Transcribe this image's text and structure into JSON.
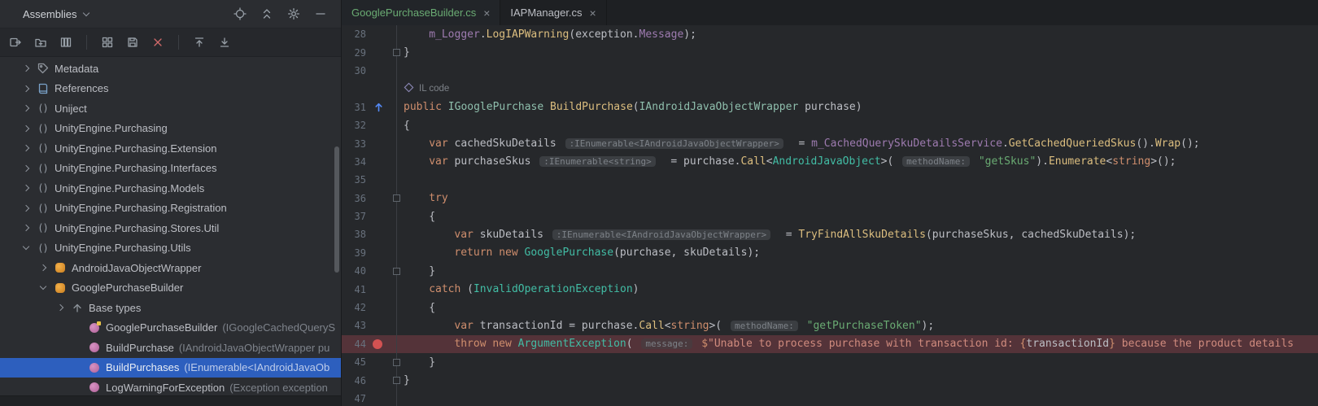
{
  "colors": {
    "selection_blue": "#2D5FBE",
    "tab_active_green": "#6AAB73",
    "breakpoint_red": "#D25252",
    "breakpoint_line_bg": "#543339",
    "keyword_orange": "#CF8E6D",
    "string_green": "#6AAB73"
  },
  "assembly_explorer": {
    "title": "Assemblies",
    "header_icons": [
      "locate-icon",
      "collapse-all-icon",
      "settings-icon",
      "hide-panel-icon"
    ],
    "toolbar_icons": [
      "open-assembly-icon",
      "attach-assembly-icon",
      "assembly-list-icon",
      "export-project-icon",
      "save-icon",
      "remove-assembly-icon",
      "collapse-to-top-icon",
      "expand-to-bottom-icon"
    ],
    "tree": [
      {
        "label": "Metadata",
        "icon": "metadata",
        "level": 0,
        "state": "collapsed"
      },
      {
        "label": "References",
        "icon": "references",
        "level": 0,
        "state": "collapsed"
      },
      {
        "label": "Uniject",
        "icon": "namespace",
        "level": 0,
        "state": "collapsed"
      },
      {
        "label": "UnityEngine.Purchasing",
        "icon": "namespace",
        "level": 0,
        "state": "collapsed"
      },
      {
        "label": "UnityEngine.Purchasing.Extension",
        "icon": "namespace",
        "level": 0,
        "state": "collapsed"
      },
      {
        "label": "UnityEngine.Purchasing.Interfaces",
        "icon": "namespace",
        "level": 0,
        "state": "collapsed"
      },
      {
        "label": "UnityEngine.Purchasing.Models",
        "icon": "namespace",
        "level": 0,
        "state": "collapsed"
      },
      {
        "label": "UnityEngine.Purchasing.Registration",
        "icon": "namespace",
        "level": 0,
        "state": "collapsed"
      },
      {
        "label": "UnityEngine.Purchasing.Stores.Util",
        "icon": "namespace",
        "level": 0,
        "state": "collapsed"
      },
      {
        "label": "UnityEngine.Purchasing.Utils",
        "icon": "namespace",
        "level": 0,
        "state": "expanded"
      },
      {
        "label": "AndroidJavaObjectWrapper",
        "icon": "class",
        "level": 1,
        "state": "collapsed"
      },
      {
        "label": "GooglePurchaseBuilder",
        "icon": "class",
        "level": 1,
        "state": "expanded"
      },
      {
        "label": "Base types",
        "icon": "base-types",
        "level": 2,
        "state": "collapsed"
      },
      {
        "label": "GooglePurchaseBuilder",
        "detail": "(IGoogleCachedQueryS",
        "icon": "constructor",
        "level": 2,
        "state": "leaf"
      },
      {
        "label": "BuildPurchase",
        "detail": "(IAndroidJavaObjectWrapper pu",
        "icon": "method",
        "level": 2,
        "state": "leaf"
      },
      {
        "label": "BuildPurchases",
        "detail": "(IEnumerable<IAndroidJavaOb",
        "icon": "method",
        "level": 2,
        "state": "leaf",
        "selected": true
      },
      {
        "label": "LogWarningForException",
        "detail": "(Exception exception",
        "icon": "method",
        "level": 2,
        "state": "leaf"
      }
    ]
  },
  "tabs": [
    {
      "label": "GooglePurchaseBuilder.cs",
      "active": true
    },
    {
      "label": "IAPManager.cs",
      "active": false
    }
  ],
  "editor": {
    "il_label": "IL code",
    "rows": [
      {
        "n": 28,
        "ind": 1,
        "t": [
          [
            "fld",
            "m_Logger"
          ],
          [
            "pl",
            "."
          ],
          [
            "mth",
            "LogIAPWarning"
          ],
          [
            "pl",
            "("
          ],
          [
            "pl",
            "exception"
          ],
          [
            "pl",
            "."
          ],
          [
            "fld",
            "Message"
          ],
          [
            "pl",
            ");"
          ]
        ]
      },
      {
        "n": 29,
        "ind": 0,
        "fold": true,
        "t": [
          [
            "pl",
            "}"
          ]
        ]
      },
      {
        "n": 30,
        "ind": 0,
        "t": []
      },
      {
        "inlay": true
      },
      {
        "n": 31,
        "ind": 0,
        "gutter_icon": "implements-arrow-icon",
        "t": [
          [
            "kw",
            "public "
          ],
          [
            "ifc",
            "IGooglePurchase "
          ],
          [
            "mth",
            "BuildPurchase"
          ],
          [
            "pl",
            "("
          ],
          [
            "ifc",
            "IAndroidJavaObjectWrapper"
          ],
          [
            "pl",
            " purchase)"
          ]
        ]
      },
      {
        "n": 32,
        "ind": 0,
        "t": [
          [
            "pl",
            "{"
          ]
        ]
      },
      {
        "n": 33,
        "ind": 1,
        "t": [
          [
            "kw",
            "var "
          ],
          [
            "pl",
            "cachedSkuDetails "
          ],
          [
            "hint",
            ":IEnumerable<IAndroidJavaObjectWrapper>"
          ],
          [
            "pl",
            "  = "
          ],
          [
            "fld",
            "m_CachedQuerySkuDetailsService"
          ],
          [
            "pl",
            "."
          ],
          [
            "mth",
            "GetCachedQueriedSkus"
          ],
          [
            "pl",
            "()."
          ],
          [
            "mth",
            "Wrap"
          ],
          [
            "pl",
            "();"
          ]
        ]
      },
      {
        "n": 34,
        "ind": 1,
        "t": [
          [
            "kw",
            "var "
          ],
          [
            "pl",
            "purchaseSkus "
          ],
          [
            "hint",
            ":IEnumerable<string>"
          ],
          [
            "pl",
            "  = purchase."
          ],
          [
            "mth",
            "Call"
          ],
          [
            "pl",
            "<"
          ],
          [
            "typ",
            "AndroidJavaObject"
          ],
          [
            "pl",
            ">( "
          ],
          [
            "hint",
            "methodName:"
          ],
          [
            "pl",
            " "
          ],
          [
            "str",
            "\"getSkus\""
          ],
          [
            "pl",
            ")."
          ],
          [
            "mth",
            "Enumerate"
          ],
          [
            "pl",
            "<"
          ],
          [
            "kw",
            "string"
          ],
          [
            "pl",
            ">();"
          ]
        ]
      },
      {
        "n": 35,
        "ind": 0,
        "t": []
      },
      {
        "n": 36,
        "ind": 1,
        "fold": true,
        "t": [
          [
            "kw",
            "try"
          ]
        ]
      },
      {
        "n": 37,
        "ind": 1,
        "t": [
          [
            "pl",
            "{"
          ]
        ]
      },
      {
        "n": 38,
        "ind": 2,
        "t": [
          [
            "kw",
            "var "
          ],
          [
            "pl",
            "skuDetails "
          ],
          [
            "hint",
            ":IEnumerable<IAndroidJavaObjectWrapper>"
          ],
          [
            "pl",
            "  = "
          ],
          [
            "mth",
            "TryFindAllSkuDetails"
          ],
          [
            "pl",
            "(purchaseSkus, cachedSkuDetails);"
          ]
        ]
      },
      {
        "n": 39,
        "ind": 2,
        "t": [
          [
            "kw",
            "return "
          ],
          [
            "kw",
            "new "
          ],
          [
            "typ",
            "GooglePurchase"
          ],
          [
            "pl",
            "(purchase, skuDetails);"
          ]
        ]
      },
      {
        "n": 40,
        "ind": 1,
        "fold": true,
        "t": [
          [
            "pl",
            "}"
          ]
        ]
      },
      {
        "n": 41,
        "ind": 1,
        "t": [
          [
            "kw",
            "catch"
          ],
          [
            "pl",
            " ("
          ],
          [
            "typ",
            "InvalidOperationException"
          ],
          [
            "pl",
            ")"
          ]
        ]
      },
      {
        "n": 42,
        "ind": 1,
        "t": [
          [
            "pl",
            "{"
          ]
        ]
      },
      {
        "n": 43,
        "ind": 2,
        "t": [
          [
            "kw",
            "var "
          ],
          [
            "pl",
            "transactionId = purchase."
          ],
          [
            "mth",
            "Call"
          ],
          [
            "pl",
            "<"
          ],
          [
            "kw",
            "string"
          ],
          [
            "pl",
            ">( "
          ],
          [
            "hint",
            "methodName:"
          ],
          [
            "pl",
            " "
          ],
          [
            "str",
            "\"getPurchaseToken\""
          ],
          [
            "pl",
            ");"
          ]
        ]
      },
      {
        "n": 44,
        "ind": 2,
        "breakpoint": true,
        "t": [
          [
            "kw",
            "throw "
          ],
          [
            "kw",
            "new "
          ],
          [
            "typ",
            "ArgumentException"
          ],
          [
            "pl",
            "( "
          ],
          [
            "hint",
            "message:"
          ],
          [
            "pl",
            " "
          ],
          [
            "kw",
            "$"
          ],
          [
            "strr",
            "\"Unable to process purchase with transaction id: "
          ],
          [
            "kw",
            "{"
          ],
          [
            "pl",
            "transactionId"
          ],
          [
            "kw",
            "}"
          ],
          [
            "strr",
            " because the product details"
          ]
        ]
      },
      {
        "n": 45,
        "ind": 1,
        "fold": true,
        "t": [
          [
            "pl",
            "}"
          ]
        ]
      },
      {
        "n": 46,
        "ind": 0,
        "fold": true,
        "t": [
          [
            "pl",
            "}"
          ]
        ]
      },
      {
        "n": 47,
        "ind": 0,
        "t": []
      }
    ]
  }
}
